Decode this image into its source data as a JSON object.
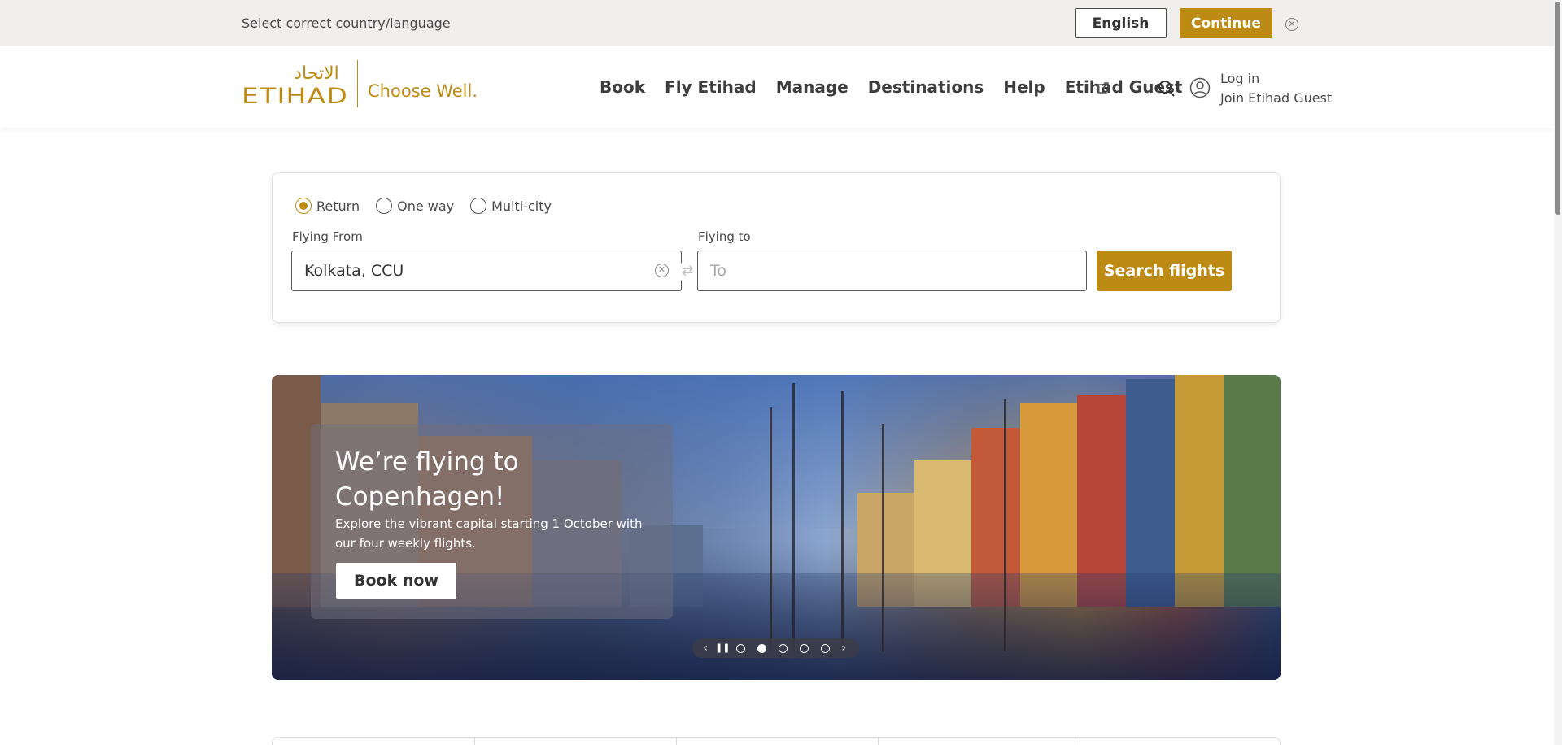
{
  "country_bar": {
    "text": "Select correct country/language",
    "language_button": "English",
    "continue_button": "Continue",
    "close_icon": "close-icon"
  },
  "header": {
    "logo_text": "ETIHAD",
    "logo_arabic": "الاتحاد",
    "tagline": "Choose Well.",
    "nav": [
      "Book",
      "Fly Etihad",
      "Manage",
      "Destinations",
      "Help",
      "Etihad Guest"
    ],
    "login": "Log in",
    "join": "Join Etihad Guest"
  },
  "booking": {
    "trip_types": [
      {
        "label": "Return",
        "checked": true
      },
      {
        "label": "One way",
        "checked": false
      },
      {
        "label": "Multi-city",
        "checked": false
      }
    ],
    "from_label": "Flying From",
    "from_value": "Kolkata, CCU",
    "to_label": "Flying to",
    "to_placeholder": "To",
    "search_button": "Search flights"
  },
  "hero": {
    "title": "We’re flying to Copenhagen!",
    "subtitle": "Explore the vibrant capital starting 1 October with our four weekly flights.",
    "cta": "Book now",
    "slides": 5,
    "active_slide": 2
  },
  "colors": {
    "brand_gold": "#bd8b13",
    "bar_bg": "#f1eeee",
    "text_dark": "#3d3d3d"
  }
}
